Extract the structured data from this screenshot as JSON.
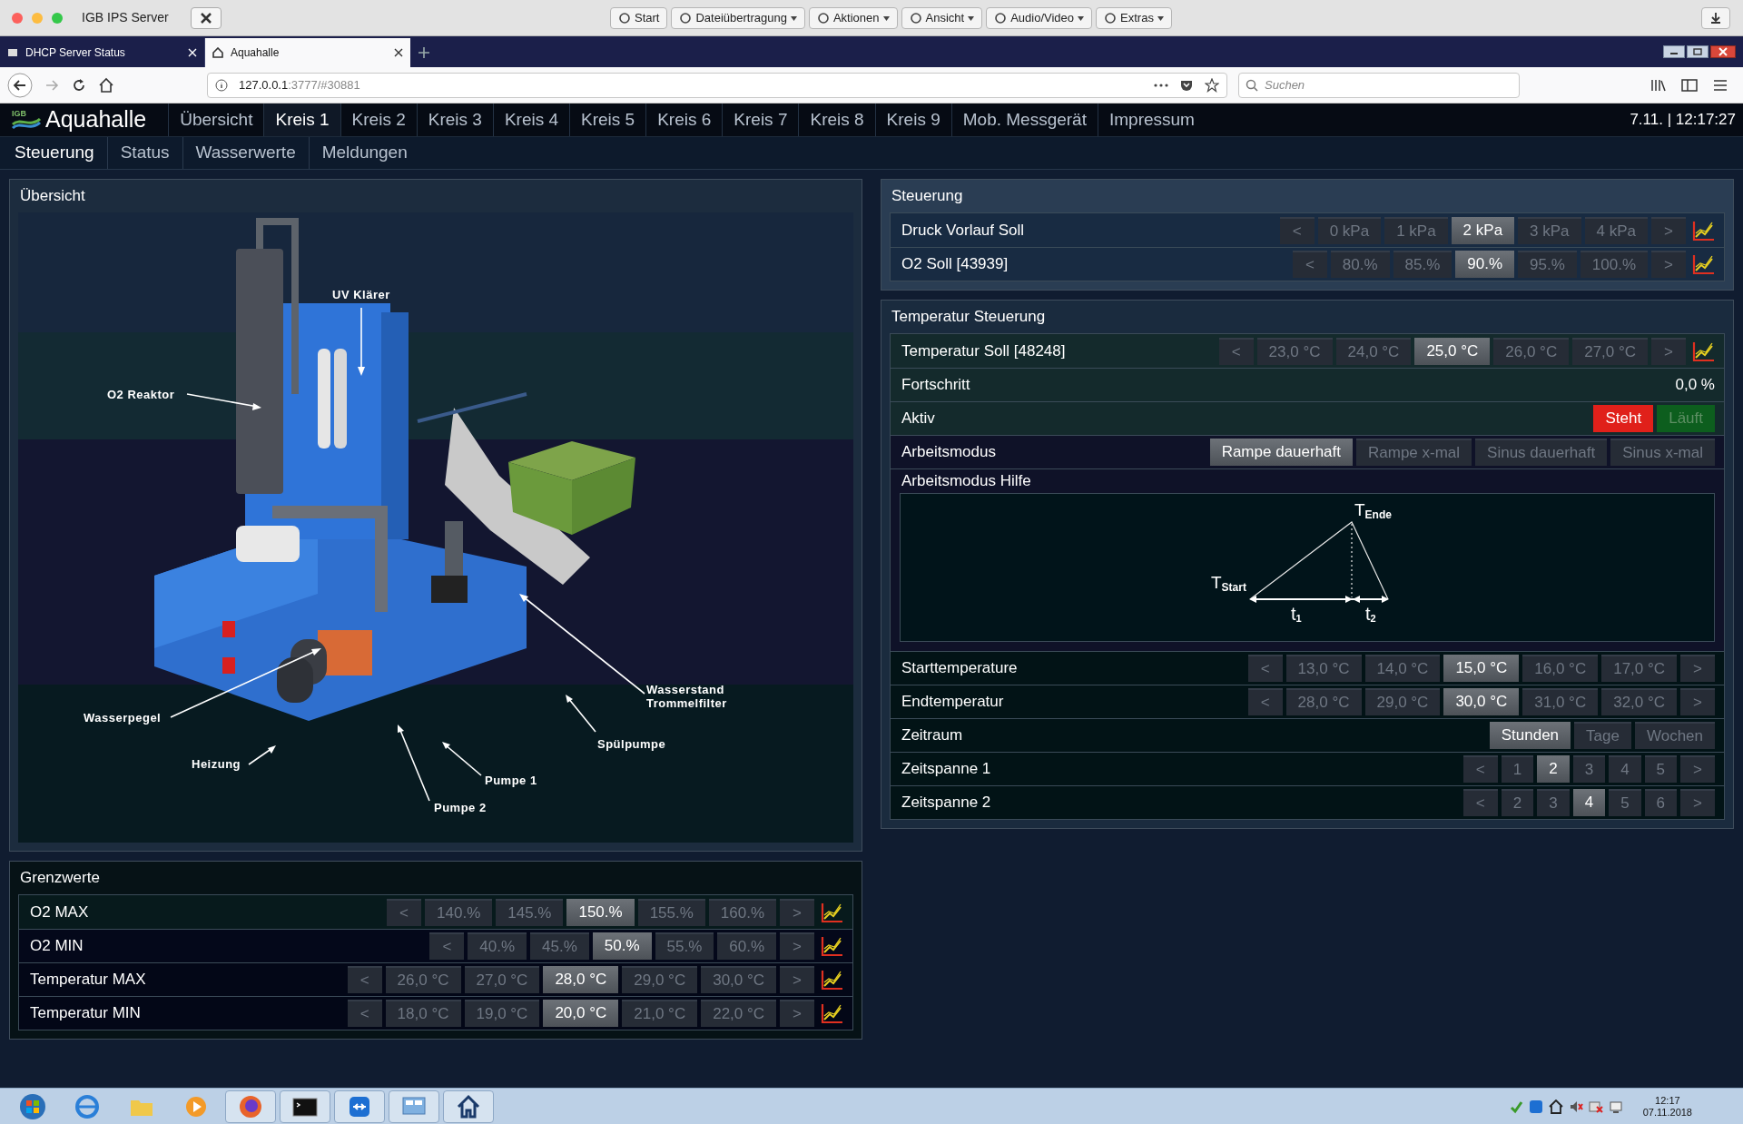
{
  "browser": {
    "window_title": "IGB IPS Server",
    "toolbar": [
      {
        "label": "Start",
        "dropdown": false
      },
      {
        "label": "Dateiübertragung",
        "dropdown": true
      },
      {
        "label": "Aktionen",
        "dropdown": true
      },
      {
        "label": "Ansicht",
        "dropdown": true
      },
      {
        "label": "Audio/Video",
        "dropdown": true
      },
      {
        "label": "Extras",
        "dropdown": true
      }
    ],
    "tabs": [
      {
        "label": "DHCP Server Status",
        "selected": false
      },
      {
        "label": "Aquahalle",
        "selected": true
      }
    ],
    "url_host": "127.0.0.1",
    "url_rest": ":3777/#30881",
    "search_placeholder": "Suchen"
  },
  "app": {
    "logo": "IGB",
    "title": "Aquahalle",
    "nav": [
      {
        "label": "Übersicht",
        "selected": false
      },
      {
        "label": "Kreis 1",
        "selected": true
      },
      {
        "label": "Kreis 2",
        "selected": false
      },
      {
        "label": "Kreis 3",
        "selected": false
      },
      {
        "label": "Kreis 4",
        "selected": false
      },
      {
        "label": "Kreis 5",
        "selected": false
      },
      {
        "label": "Kreis 6",
        "selected": false
      },
      {
        "label": "Kreis 7",
        "selected": false
      },
      {
        "label": "Kreis 8",
        "selected": false
      },
      {
        "label": "Kreis 9",
        "selected": false
      },
      {
        "label": "Mob. Messgerät",
        "selected": false
      },
      {
        "label": "Impressum",
        "selected": false
      }
    ],
    "clock": "7.11. | 12:17:27",
    "subnav": [
      {
        "label": "Steuerung",
        "selected": true
      },
      {
        "label": "Status",
        "selected": false
      },
      {
        "label": "Wasserwerte",
        "selected": false
      },
      {
        "label": "Meldungen",
        "selected": false
      }
    ]
  },
  "overview": {
    "title": "Übersicht",
    "labels": [
      {
        "text": "UV Klärer",
        "kind": "top"
      },
      {
        "text": "O2 Reaktor",
        "kind": "left"
      },
      {
        "text": "Wasserpegel",
        "kind": "left"
      },
      {
        "text": "Heizung",
        "kind": "left"
      },
      {
        "text": "Wasserstand\nTrommelfilter",
        "kind": "right"
      },
      {
        "text": "Spülpumpe",
        "kind": "right"
      },
      {
        "text": "Pumpe 1",
        "kind": "right"
      },
      {
        "text": "Pumpe 2",
        "kind": "right"
      }
    ]
  },
  "limits": {
    "title": "Grenzwerte",
    "rows": [
      {
        "kind": "stepper",
        "label": "O2 MAX",
        "chart_link": true,
        "options": [
          {
            "label": "<",
            "kind": "arrow",
            "selected": false
          },
          {
            "label": "140.%",
            "kind": "value",
            "selected": false
          },
          {
            "label": "145.%",
            "kind": "value",
            "selected": false
          },
          {
            "label": "150.%",
            "kind": "value",
            "selected": true
          },
          {
            "label": "155.%",
            "kind": "value",
            "selected": false
          },
          {
            "label": "160.%",
            "kind": "value",
            "selected": false
          },
          {
            "label": ">",
            "kind": "arrow",
            "selected": false
          }
        ]
      },
      {
        "kind": "stepper",
        "label": "O2 MIN",
        "chart_link": true,
        "options": [
          {
            "label": "<",
            "kind": "arrow",
            "selected": false
          },
          {
            "label": "40.%",
            "kind": "value",
            "selected": false
          },
          {
            "label": "45.%",
            "kind": "value",
            "selected": false
          },
          {
            "label": "50.%",
            "kind": "value",
            "selected": true
          },
          {
            "label": "55.%",
            "kind": "value",
            "selected": false
          },
          {
            "label": "60.%",
            "kind": "value",
            "selected": false
          },
          {
            "label": ">",
            "kind": "arrow",
            "selected": false
          }
        ]
      },
      {
        "kind": "stepper",
        "label": "Temperatur MAX",
        "chart_link": true,
        "options": [
          {
            "label": "<",
            "kind": "arrow",
            "selected": false
          },
          {
            "label": "26,0 °C",
            "kind": "value",
            "selected": false
          },
          {
            "label": "27,0 °C",
            "kind": "value",
            "selected": false
          },
          {
            "label": "28,0 °C",
            "kind": "value",
            "selected": true
          },
          {
            "label": "29,0 °C",
            "kind": "value",
            "selected": false
          },
          {
            "label": "30,0 °C",
            "kind": "value",
            "selected": false
          },
          {
            "label": ">",
            "kind": "arrow",
            "selected": false
          }
        ]
      },
      {
        "kind": "stepper",
        "label": "Temperatur MIN",
        "chart_link": true,
        "options": [
          {
            "label": "<",
            "kind": "arrow",
            "selected": false
          },
          {
            "label": "18,0 °C",
            "kind": "value",
            "selected": false
          },
          {
            "label": "19,0 °C",
            "kind": "value",
            "selected": false
          },
          {
            "label": "20,0 °C",
            "kind": "value",
            "selected": true
          },
          {
            "label": "21,0 °C",
            "kind": "value",
            "selected": false
          },
          {
            "label": "22,0 °C",
            "kind": "value",
            "selected": false
          },
          {
            "label": ">",
            "kind": "arrow",
            "selected": false
          }
        ]
      }
    ]
  },
  "control": {
    "title": "Steuerung",
    "rows": [
      {
        "kind": "stepper",
        "label": "Druck Vorlauf Soll",
        "chart_link": true,
        "options": [
          {
            "label": "<",
            "kind": "arrow",
            "selected": false
          },
          {
            "label": "0 kPa",
            "kind": "value",
            "selected": false
          },
          {
            "label": "1 kPa",
            "kind": "value",
            "selected": false
          },
          {
            "label": "2 kPa",
            "kind": "value",
            "selected": true
          },
          {
            "label": "3 kPa",
            "kind": "value",
            "selected": false
          },
          {
            "label": "4 kPa",
            "kind": "value",
            "selected": false
          },
          {
            "label": ">",
            "kind": "arrow",
            "selected": false
          }
        ]
      },
      {
        "kind": "stepper",
        "label": "O2 Soll [43939]",
        "chart_link": true,
        "options": [
          {
            "label": "<",
            "kind": "arrow",
            "selected": false
          },
          {
            "label": "80.%",
            "kind": "value",
            "selected": false
          },
          {
            "label": "85.%",
            "kind": "value",
            "selected": false
          },
          {
            "label": "90.%",
            "kind": "value",
            "selected": true
          },
          {
            "label": "95.%",
            "kind": "value",
            "selected": false
          },
          {
            "label": "100.%",
            "kind": "value",
            "selected": false
          },
          {
            "label": ">",
            "kind": "arrow",
            "selected": false
          }
        ]
      }
    ]
  },
  "temperature": {
    "title": "Temperatur Steuerung",
    "rows": [
      {
        "kind": "stepper",
        "label": "Temperatur Soll [48248]",
        "chart_link": true,
        "options": [
          {
            "label": "<",
            "kind": "arrow",
            "selected": false
          },
          {
            "label": "23,0 °C",
            "kind": "value",
            "selected": false
          },
          {
            "label": "24,0 °C",
            "kind": "value",
            "selected": false
          },
          {
            "label": "25,0 °C",
            "kind": "value",
            "selected": true
          },
          {
            "label": "26,0 °C",
            "kind": "value",
            "selected": false
          },
          {
            "label": "27,0 °C",
            "kind": "value",
            "selected": false
          },
          {
            "label": ">",
            "kind": "arrow",
            "selected": false
          }
        ]
      },
      {
        "kind": "value",
        "label": "Fortschritt",
        "value": "0,0 %"
      },
      {
        "kind": "toggle",
        "label": "Aktiv",
        "options": [
          {
            "label": "Steht",
            "selected": true,
            "color": "#e0201a"
          },
          {
            "label": "Läuft",
            "selected": false,
            "color": "#0d5e1e"
          }
        ]
      },
      {
        "kind": "choice",
        "label": "Arbeitsmodus",
        "options": [
          {
            "label": "Rampe dauerhaft",
            "kind": "value",
            "selected": true
          },
          {
            "label": "Rampe x-mal",
            "kind": "value",
            "selected": false
          },
          {
            "label": "Sinus dauerhaft",
            "kind": "value",
            "selected": false
          },
          {
            "label": "Sinus x-mal",
            "kind": "value",
            "selected": false
          }
        ]
      },
      {
        "kind": "help",
        "label": "Arbeitsmodus Hilfe",
        "diagram": {
          "t_end": "T$_{Ende}$",
          "t_start": "T$_{Start}$",
          "t1": "t$_{1}$",
          "t2": "t$_{2}$"
        }
      },
      {
        "kind": "stepper",
        "label": "Starttemperature",
        "chart_link": false,
        "options": [
          {
            "label": "<",
            "kind": "arrow",
            "selected": false
          },
          {
            "label": "13,0 °C",
            "kind": "value",
            "selected": false
          },
          {
            "label": "14,0 °C",
            "kind": "value",
            "selected": false
          },
          {
            "label": "15,0 °C",
            "kind": "value",
            "selected": true
          },
          {
            "label": "16,0 °C",
            "kind": "value",
            "selected": false
          },
          {
            "label": "17,0 °C",
            "kind": "value",
            "selected": false
          },
          {
            "label": ">",
            "kind": "arrow",
            "selected": false
          }
        ]
      },
      {
        "kind": "stepper",
        "label": "Endtemperatur",
        "chart_link": false,
        "options": [
          {
            "label": "<",
            "kind": "arrow",
            "selected": false
          },
          {
            "label": "28,0 °C",
            "kind": "value",
            "selected": false
          },
          {
            "label": "29,0 °C",
            "kind": "value",
            "selected": false
          },
          {
            "label": "30,0 °C",
            "kind": "value",
            "selected": true
          },
          {
            "label": "31,0 °C",
            "kind": "value",
            "selected": false
          },
          {
            "label": "32,0 °C",
            "kind": "value",
            "selected": false
          },
          {
            "label": ">",
            "kind": "arrow",
            "selected": false
          }
        ]
      },
      {
        "kind": "choice",
        "label": "Zeitraum",
        "options": [
          {
            "label": "Stunden",
            "kind": "value",
            "selected": true
          },
          {
            "label": "Tage",
            "kind": "value",
            "selected": false
          },
          {
            "label": "Wochen",
            "kind": "value",
            "selected": false
          }
        ]
      },
      {
        "kind": "stepper",
        "label": "Zeitspanne 1",
        "chart_link": false,
        "options": [
          {
            "label": "<",
            "kind": "arrow",
            "selected": false
          },
          {
            "label": "1",
            "kind": "value",
            "selected": false
          },
          {
            "label": "2",
            "kind": "value",
            "selected": true
          },
          {
            "label": "3",
            "kind": "value",
            "selected": false
          },
          {
            "label": "4",
            "kind": "value",
            "selected": false
          },
          {
            "label": "5",
            "kind": "value",
            "selected": false
          },
          {
            "label": ">",
            "kind": "arrow",
            "selected": false
          }
        ]
      },
      {
        "kind": "stepper",
        "label": "Zeitspanne 2",
        "chart_link": false,
        "options": [
          {
            "label": "<",
            "kind": "arrow",
            "selected": false
          },
          {
            "label": "2",
            "kind": "value",
            "selected": false
          },
          {
            "label": "3",
            "kind": "value",
            "selected": false
          },
          {
            "label": "4",
            "kind": "value",
            "selected": true
          },
          {
            "label": "5",
            "kind": "value",
            "selected": false
          },
          {
            "label": "6",
            "kind": "value",
            "selected": false
          },
          {
            "label": ">",
            "kind": "arrow",
            "selected": false
          }
        ]
      }
    ]
  },
  "taskbar": {
    "time": "12:17",
    "date": "07.11.2018"
  }
}
